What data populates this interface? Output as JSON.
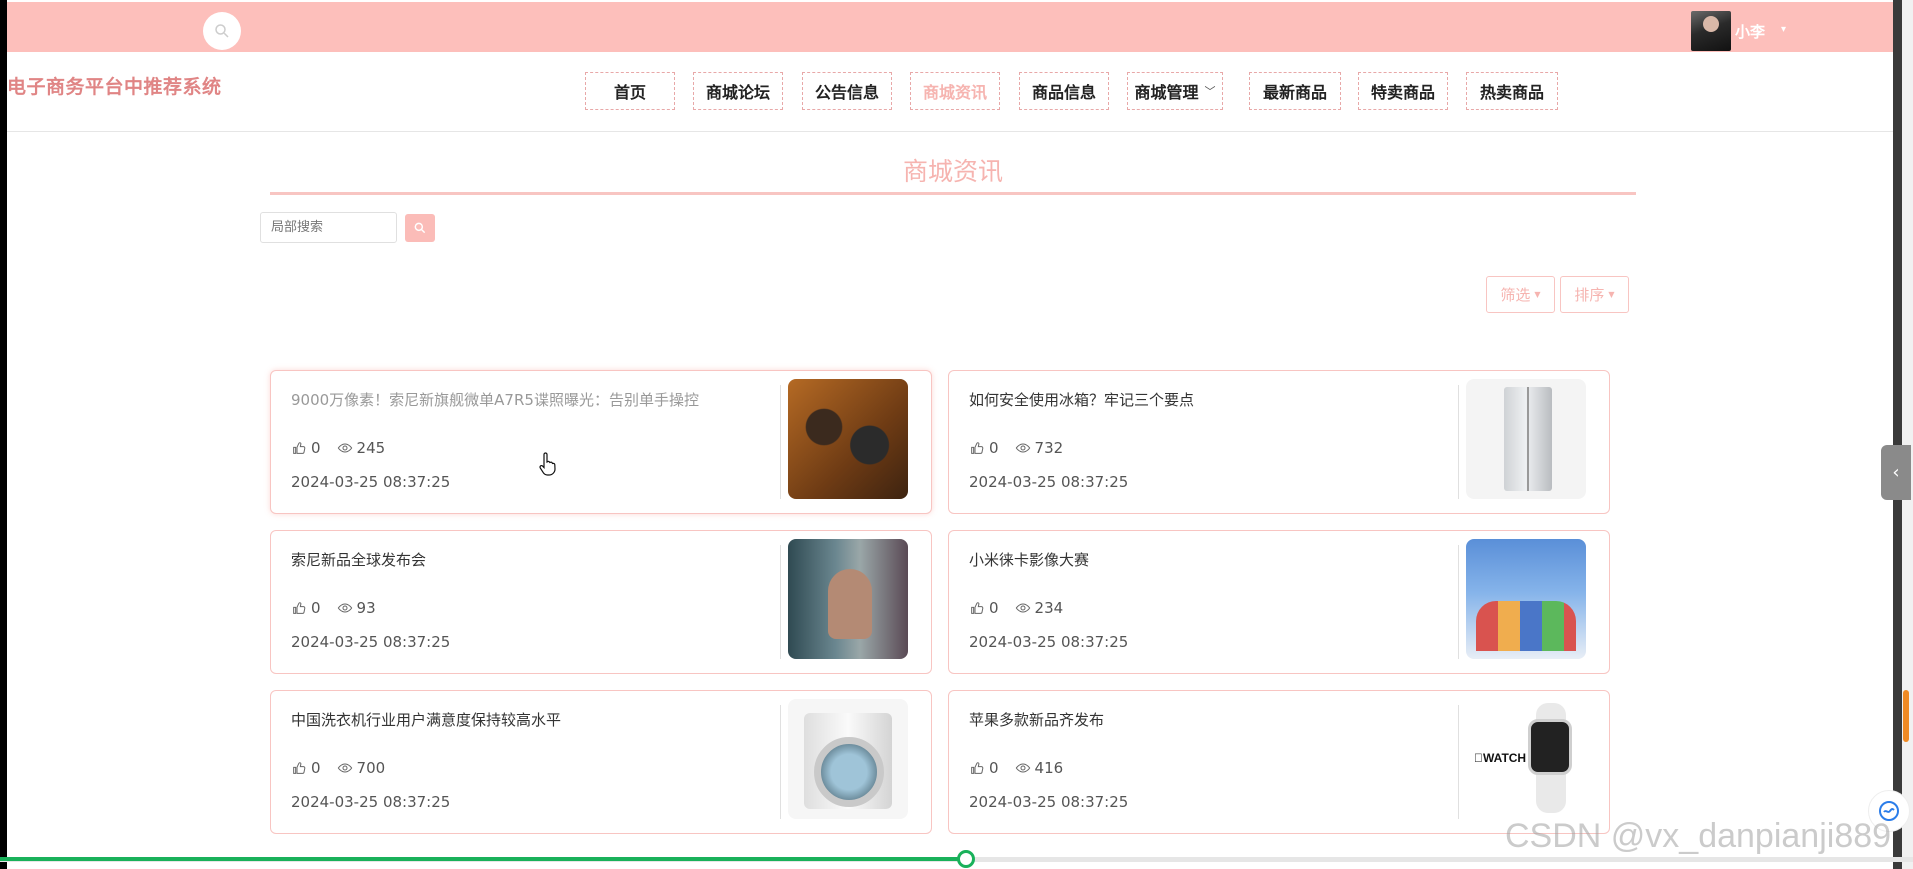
{
  "topbar": {
    "user_name": "小李",
    "user_caret": "▾"
  },
  "header": {
    "site_title": "电子商务平台中推荐系统"
  },
  "nav": {
    "items": [
      {
        "label": "首页",
        "active": false
      },
      {
        "label": "商城论坛",
        "active": false
      },
      {
        "label": "公告信息",
        "active": false
      },
      {
        "label": "商城资讯",
        "active": true
      },
      {
        "label": "商品信息",
        "active": false
      },
      {
        "label": "商城管理",
        "active": false,
        "has_dropdown": true
      },
      {
        "label": "最新商品",
        "active": false
      },
      {
        "label": "特卖商品",
        "active": false
      },
      {
        "label": "热卖商品",
        "active": false
      }
    ],
    "dropdown_chevron": "﹀"
  },
  "section": {
    "title": "商城资讯"
  },
  "search": {
    "placeholder": "局部搜索"
  },
  "filters": {
    "filter_label": "筛选",
    "sort_label": "排序"
  },
  "cards": [
    {
      "title": "9000万像素！索尼新旗舰微单A7R5谍照曝光：告别单手操控",
      "likes": "0",
      "views": "245",
      "date": "2024-03-25 08:37:25",
      "thumb": "camera",
      "hovered": true
    },
    {
      "title": "如何安全使用冰箱？牢记三个要点",
      "likes": "0",
      "views": "732",
      "date": "2024-03-25 08:37:25",
      "thumb": "fridge",
      "hovered": false
    },
    {
      "title": "索尼新品全球发布会",
      "likes": "0",
      "views": "93",
      "date": "2024-03-25 08:37:25",
      "thumb": "astro",
      "hovered": false
    },
    {
      "title": "小米徕卡影像大赛",
      "likes": "0",
      "views": "234",
      "date": "2024-03-25 08:37:25",
      "thumb": "kids",
      "hovered": false
    },
    {
      "title": "中国洗衣机行业用户满意度保持较高水平",
      "likes": "0",
      "views": "700",
      "date": "2024-03-25 08:37:25",
      "thumb": "washer",
      "hovered": false
    },
    {
      "title": "苹果多款新品齐发布",
      "likes": "0",
      "views": "416",
      "date": "2024-03-25 08:37:25",
      "thumb": "watch",
      "watch_label": "WATCH",
      "hovered": false
    }
  ],
  "video": {
    "progress": 0.505
  },
  "watermark": "CSDN @vx_danpianji889",
  "colors": {
    "accent": "#fdbfbb",
    "accent_text": "#f6b4b0",
    "title_red": "#e08585",
    "progress": "#19b15a"
  },
  "icons": {
    "search": "search-icon",
    "like": "thumbs-up-icon",
    "view": "eye-icon",
    "side": "chevron-left-icon",
    "cursor": "hand-pointer-icon"
  }
}
